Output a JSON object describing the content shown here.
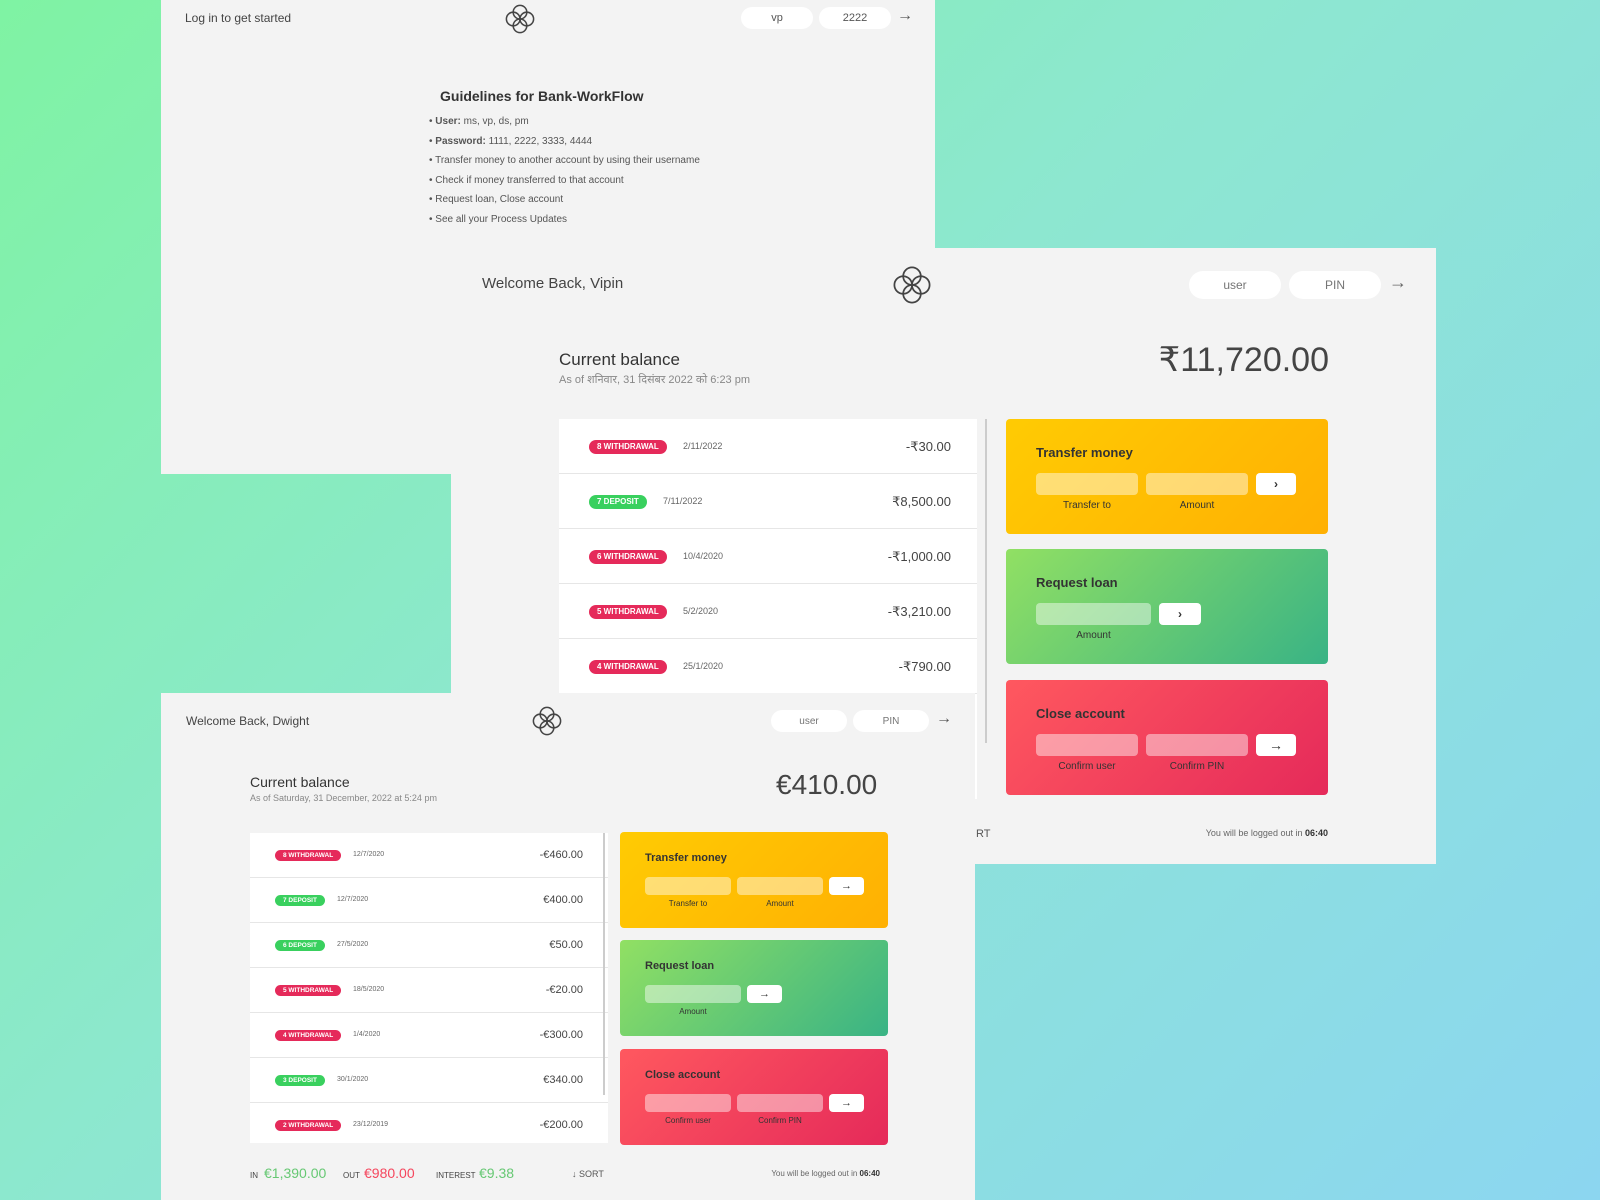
{
  "panel1": {
    "prompt": "Log in to get started",
    "user_value": "vp",
    "pin_value": "2222",
    "arrow": "→",
    "guidelines_title": "Guidelines for Bank-WorkFlow",
    "items": [
      {
        "label": "User:",
        "text": " ms, vp, ds, pm"
      },
      {
        "label": "Password:",
        "text": " 1111, 2222, 3333, 4444"
      },
      {
        "label": "",
        "text": "Transfer money to another account by using their username"
      },
      {
        "label": "",
        "text": "Check if money transferred to that account"
      },
      {
        "label": "",
        "text": "Request loan, Close account"
      },
      {
        "label": "",
        "text": "See all your Process Updates"
      }
    ]
  },
  "panel2": {
    "welcome": "Welcome Back, Vipin",
    "user_placeholder": "user",
    "pin_placeholder": "PIN",
    "arrow": "→",
    "balance_label": "Current balance",
    "balance_date": "As of शनिवार, 31 दिसंबर 2022 को 6:23 pm",
    "balance_value": "₹11,720.00",
    "movements": [
      {
        "type": "8 withdrawal",
        "kind": "w",
        "date": "2/11/2022",
        "value": "-₹30.00"
      },
      {
        "type": "7 deposit",
        "kind": "d",
        "date": "7/11/2022",
        "value": "₹8,500.00"
      },
      {
        "type": "6 withdrawal",
        "kind": "w",
        "date": "10/4/2020",
        "value": "-₹1,000.00"
      },
      {
        "type": "5 withdrawal",
        "kind": "w",
        "date": "5/2/2020",
        "value": "-₹3,210.00"
      },
      {
        "type": "4 withdrawal",
        "kind": "w",
        "date": "25/1/2020",
        "value": "-₹790.00"
      }
    ],
    "transfer_title": "Transfer money",
    "transfer_to_label": "Transfer to",
    "transfer_amount_label": "Amount",
    "transfer_btn": "›",
    "loan_title": "Request loan",
    "loan_amount_label": "Amount",
    "loan_btn": "›",
    "close_title": "Close account",
    "close_user_label": "Confirm user",
    "close_pin_label": "Confirm PIN",
    "close_btn": "→",
    "sort_fragment": "RT",
    "logout_text": "You will be logged out in ",
    "logout_timer": "06:40"
  },
  "panel3": {
    "welcome": "Welcome Back, Dwight",
    "user_placeholder": "user",
    "pin_placeholder": "PIN",
    "arrow": "→",
    "balance_label": "Current balance",
    "balance_date": "As of Saturday, 31 December, 2022 at 5:24 pm",
    "balance_value": "€410.00",
    "movements": [
      {
        "type": "8 withdrawal",
        "kind": "w",
        "date": "12/7/2020",
        "value": "-€460.00"
      },
      {
        "type": "7 deposit",
        "kind": "d",
        "date": "12/7/2020",
        "value": "€400.00"
      },
      {
        "type": "6 deposit",
        "kind": "d",
        "date": "27/5/2020",
        "value": "€50.00"
      },
      {
        "type": "5 withdrawal",
        "kind": "w",
        "date": "18/5/2020",
        "value": "-€20.00"
      },
      {
        "type": "4 withdrawal",
        "kind": "w",
        "date": "1/4/2020",
        "value": "-€300.00"
      },
      {
        "type": "3 deposit",
        "kind": "d",
        "date": "30/1/2020",
        "value": "€340.00"
      },
      {
        "type": "2 withdrawal",
        "kind": "w",
        "date": "23/12/2019",
        "value": "-€200.00"
      }
    ],
    "transfer_title": "Transfer money",
    "transfer_to_label": "Transfer to",
    "transfer_amount_label": "Amount",
    "transfer_btn": "→",
    "loan_title": "Request loan",
    "loan_amount_label": "Amount",
    "loan_btn": "→",
    "close_title": "Close account",
    "close_user_label": "Confirm user",
    "close_pin_label": "Confirm PIN",
    "close_btn": "→",
    "in_label": "IN",
    "in_value": "€1,390.00",
    "out_label": "OUT",
    "out_value": "€980.00",
    "interest_label": "INTEREST",
    "interest_value": "€9.38",
    "sort_label": "↓ SORT",
    "logout_text": "You will be logged out in ",
    "logout_timer": "06:40"
  },
  "colors": {
    "withdrawal": "#e52a5a",
    "deposit": "#39d05e",
    "in_value": "#66c873",
    "out_value": "#f5465d"
  }
}
